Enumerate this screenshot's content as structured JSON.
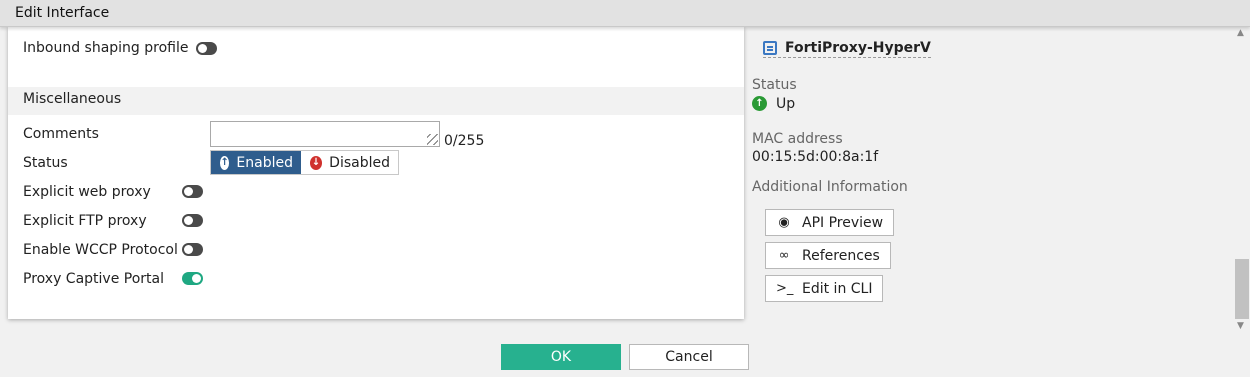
{
  "window": {
    "title": "Edit Interface"
  },
  "form": {
    "inbound_shaping_label": "Inbound shaping profile",
    "misc_section_title": "Miscellaneous",
    "comments_label": "Comments",
    "comments_value": "",
    "comments_counter": "0/255",
    "status_label": "Status",
    "status_enabled": "Enabled",
    "status_disabled": "Disabled",
    "status_selected": "Enabled",
    "explicit_web_proxy_label": "Explicit web proxy",
    "explicit_web_proxy_on": false,
    "explicit_ftp_proxy_label": "Explicit FTP proxy",
    "explicit_ftp_proxy_on": false,
    "wccp_label": "Enable WCCP Protocol",
    "wccp_on": false,
    "captive_portal_label": "Proxy Captive Portal",
    "captive_portal_on": true,
    "inbound_shaping_on": false
  },
  "side": {
    "device_name": "FortiProxy-HyperV",
    "status_label": "Status",
    "status_value": "Up",
    "mac_label": "MAC address",
    "mac_value": "00:15:5d:00:8a:1f",
    "additional_label": "Additional Information",
    "api_preview": "API Preview",
    "references": "References",
    "edit_cli": "Edit in CLI"
  },
  "footer": {
    "ok": "OK",
    "cancel": "Cancel"
  },
  "colors": {
    "accent": "#27b18f",
    "primary": "#2f5d8d",
    "toggle_on": "#1fa882",
    "status_up": "#2a9a35",
    "disabled_icon": "#d0312d"
  },
  "icons": {
    "device": "device-icon",
    "status": "arrow-up-circle-icon",
    "api_preview": "eye-icon",
    "references": "link-icon",
    "edit_cli": "terminal-icon"
  }
}
